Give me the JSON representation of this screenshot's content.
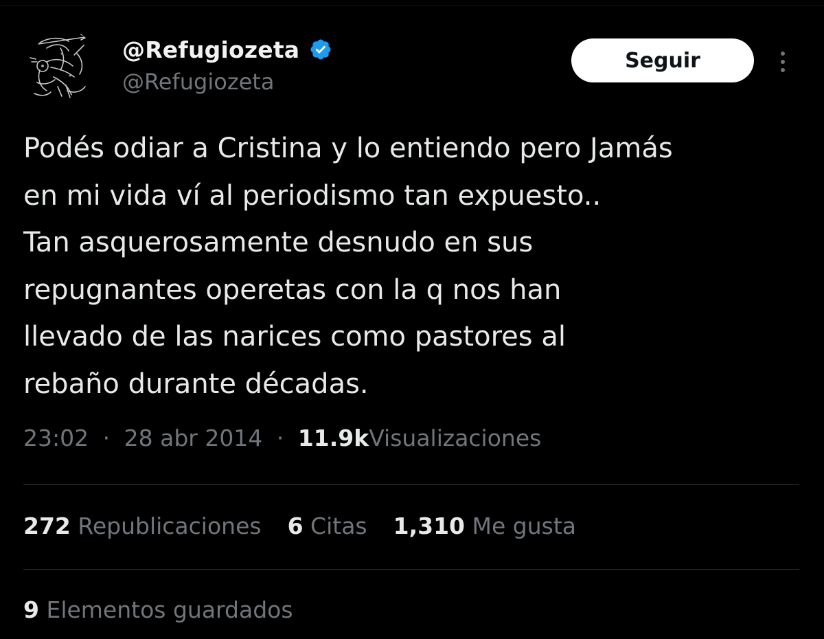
{
  "author": {
    "display_name": "@Refugiozeta",
    "handle": "@Refugiozeta",
    "verified": true,
    "avatar_icon": "cupid-sketch-avatar",
    "verified_icon": "verified-badge-icon"
  },
  "actions": {
    "follow_label": "Seguir",
    "more_icon": "more-vertical-icon"
  },
  "tweet": {
    "lines": [
      "Podés odiar a Cristina y lo entiendo pero Jamás",
      "en mi vida ví al periodismo tan expuesto..",
      "Tan asquerosamente desnudo en sus",
      "repugnantes operetas con la q nos han",
      "llevado de las narices como pastores al",
      "rebaño durante décadas."
    ],
    "time": "23:02",
    "date": "28 abr 2014",
    "separator": "·",
    "views_count": "11.9k",
    "views_label": "Visualizaciones"
  },
  "stats": {
    "reposts_count": "272",
    "reposts_label": "Republicaciones",
    "quotes_count": "6",
    "quotes_label": "Citas",
    "likes_count": "1,310",
    "likes_label": "Me gusta",
    "bookmarks_count": "9",
    "bookmarks_label": "Elementos guardados"
  },
  "colors": {
    "background": "#000000",
    "text_primary": "#e7e9ea",
    "text_secondary": "#71767b",
    "divider": "#2f3336",
    "verified_blue": "#1d9bf0",
    "button_bg": "#ffffff"
  }
}
